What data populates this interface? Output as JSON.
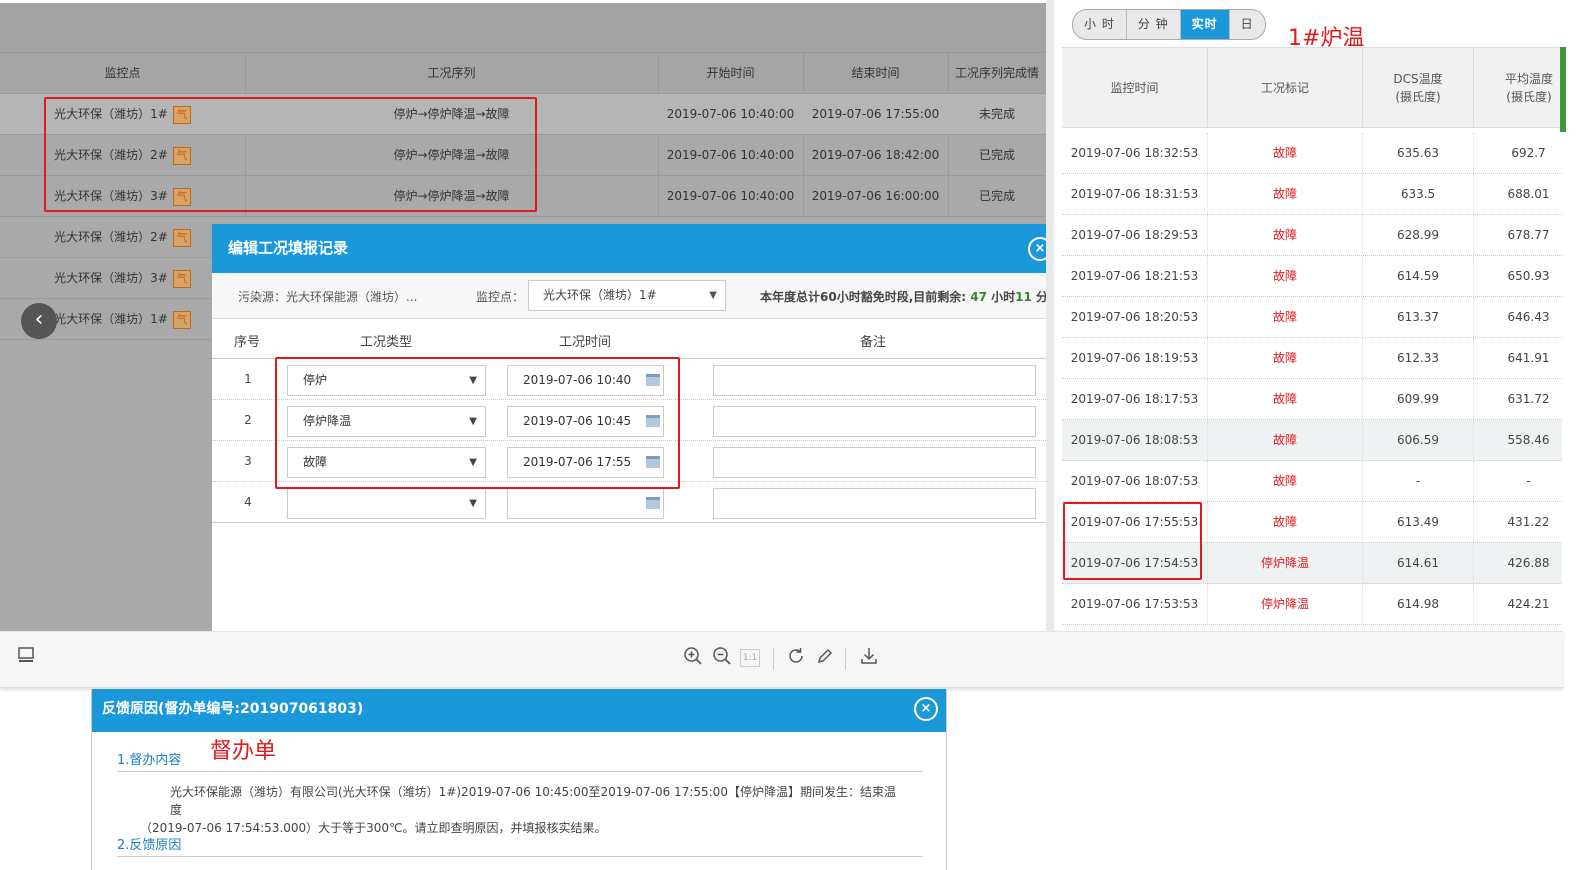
{
  "left_table": {
    "headers": [
      "监控点",
      "工况序列",
      "开始时间",
      "结束时间",
      "工况序列完成情"
    ],
    "rows": [
      {
        "point": "光大环保（潍坊）1#",
        "icon": "气",
        "sequence": "停炉→停炉降温→故障",
        "start": "2019-07-06 10:40:00",
        "end": "2019-07-06 17:55:00",
        "status": "未完成"
      },
      {
        "point": "光大环保（潍坊）2#",
        "icon": "气",
        "sequence": "停炉→停炉降温→故障",
        "start": "2019-07-06 10:40:00",
        "end": "2019-07-06 18:42:00",
        "status": "已完成"
      },
      {
        "point": "光大环保（潍坊）3#",
        "icon": "气",
        "sequence": "停炉→停炉降温→故障",
        "start": "2019-07-06 10:40:00",
        "end": "2019-07-06 16:00:00",
        "status": "已完成"
      },
      {
        "point": "光大环保（潍坊）2#",
        "icon": "气"
      },
      {
        "point": "光大环保（潍坊）3#",
        "icon": "气"
      },
      {
        "point": "光大环保（潍坊）1#",
        "icon": "气"
      }
    ]
  },
  "edit_dialog": {
    "title": "编辑工况填报记录",
    "close": "×",
    "source_label": "污染源：光大环保能源（潍坊）...",
    "point_label": "监控点：",
    "point_value": "光大环保（潍坊）1#",
    "quota_prefix": "本年度总计60小时豁免时段,目前剩余: ",
    "quota_hours": "47",
    "quota_mid": " 小时",
    "quota_minutes": "11",
    "quota_suffix": " 分钟",
    "headers": {
      "no": "序号",
      "type": "工况类型",
      "time": "工况时间",
      "remark": "备注"
    },
    "rows": [
      {
        "no": "1",
        "type": "停炉",
        "time": "2019-07-06 10:40"
      },
      {
        "no": "2",
        "type": "停炉降温",
        "time": "2019-07-06 10:45"
      },
      {
        "no": "3",
        "type": "故障",
        "time": "2019-07-06 17:55"
      },
      {
        "no": "4",
        "type": "",
        "time": ""
      }
    ]
  },
  "right_panel": {
    "segments": [
      "小 时",
      "分 钟",
      "实时",
      "日"
    ],
    "active_segment": "实时",
    "annotation": "1#炉温",
    "headers": {
      "time": "监控时间",
      "flag": "工况标记",
      "dcs_1": "DCS温度",
      "dcs_2": "(摄氏度)",
      "avg_1": "平均温度",
      "avg_2": "(摄氏度)"
    },
    "rows": [
      {
        "time": "2019-07-06 18:32:53",
        "flag": "故障",
        "dcs": "635.63",
        "avg": "692.7"
      },
      {
        "time": "2019-07-06 18:31:53",
        "flag": "故障",
        "dcs": "633.5",
        "avg": "688.01"
      },
      {
        "time": "2019-07-06 18:29:53",
        "flag": "故障",
        "dcs": "628.99",
        "avg": "678.77"
      },
      {
        "time": "2019-07-06 18:21:53",
        "flag": "故障",
        "dcs": "614.59",
        "avg": "650.93"
      },
      {
        "time": "2019-07-06 18:20:53",
        "flag": "故障",
        "dcs": "613.37",
        "avg": "646.43"
      },
      {
        "time": "2019-07-06 18:19:53",
        "flag": "故障",
        "dcs": "612.33",
        "avg": "641.91"
      },
      {
        "time": "2019-07-06 18:17:53",
        "flag": "故障",
        "dcs": "609.99",
        "avg": "631.72"
      },
      {
        "time": "2019-07-06 18:08:53",
        "flag": "故障",
        "dcs": "606.59",
        "avg": "558.46"
      },
      {
        "time": "2019-07-06 18:07:53",
        "flag": "故障",
        "dcs": "-",
        "avg": "-"
      },
      {
        "time": "2019-07-06 17:55:53",
        "flag": "故障",
        "dcs": "613.49",
        "avg": "431.22"
      },
      {
        "time": "2019-07-06 17:54:53",
        "flag": "停炉降温",
        "dcs": "614.61",
        "avg": "426.88"
      },
      {
        "time": "2019-07-06 17:53:53",
        "flag": "停炉降温",
        "dcs": "614.98",
        "avg": "424.21"
      }
    ]
  },
  "toolbar": {
    "icons": [
      "thumbnail-icon",
      "zoom-in-icon",
      "zoom-out-icon",
      "actual-size-icon",
      "rotate-icon",
      "edit-icon",
      "download-icon"
    ],
    "actual_size_label": "1:1"
  },
  "feedback_dialog": {
    "title": "反馈原因(督办单编号:201907061803)",
    "close": "×",
    "annotation": "督办单",
    "section1": "1.督办内容",
    "content_line1": "光大环保能源（潍坊）有限公司(光大环保（潍坊）1#)2019-07-06 10:45:00至2019-07-06 17:55:00【停炉降温】期间发生：结束温度",
    "content_line2": "（2019-07-06 17:54:53.000）大于等于300℃。请立即查明原因，并填报核实结果。",
    "section2": "2.反馈原因"
  },
  "colors": {
    "accent": "#1a98da",
    "annotation_red": "#e0191e",
    "done_green": "#2e8b2e"
  }
}
